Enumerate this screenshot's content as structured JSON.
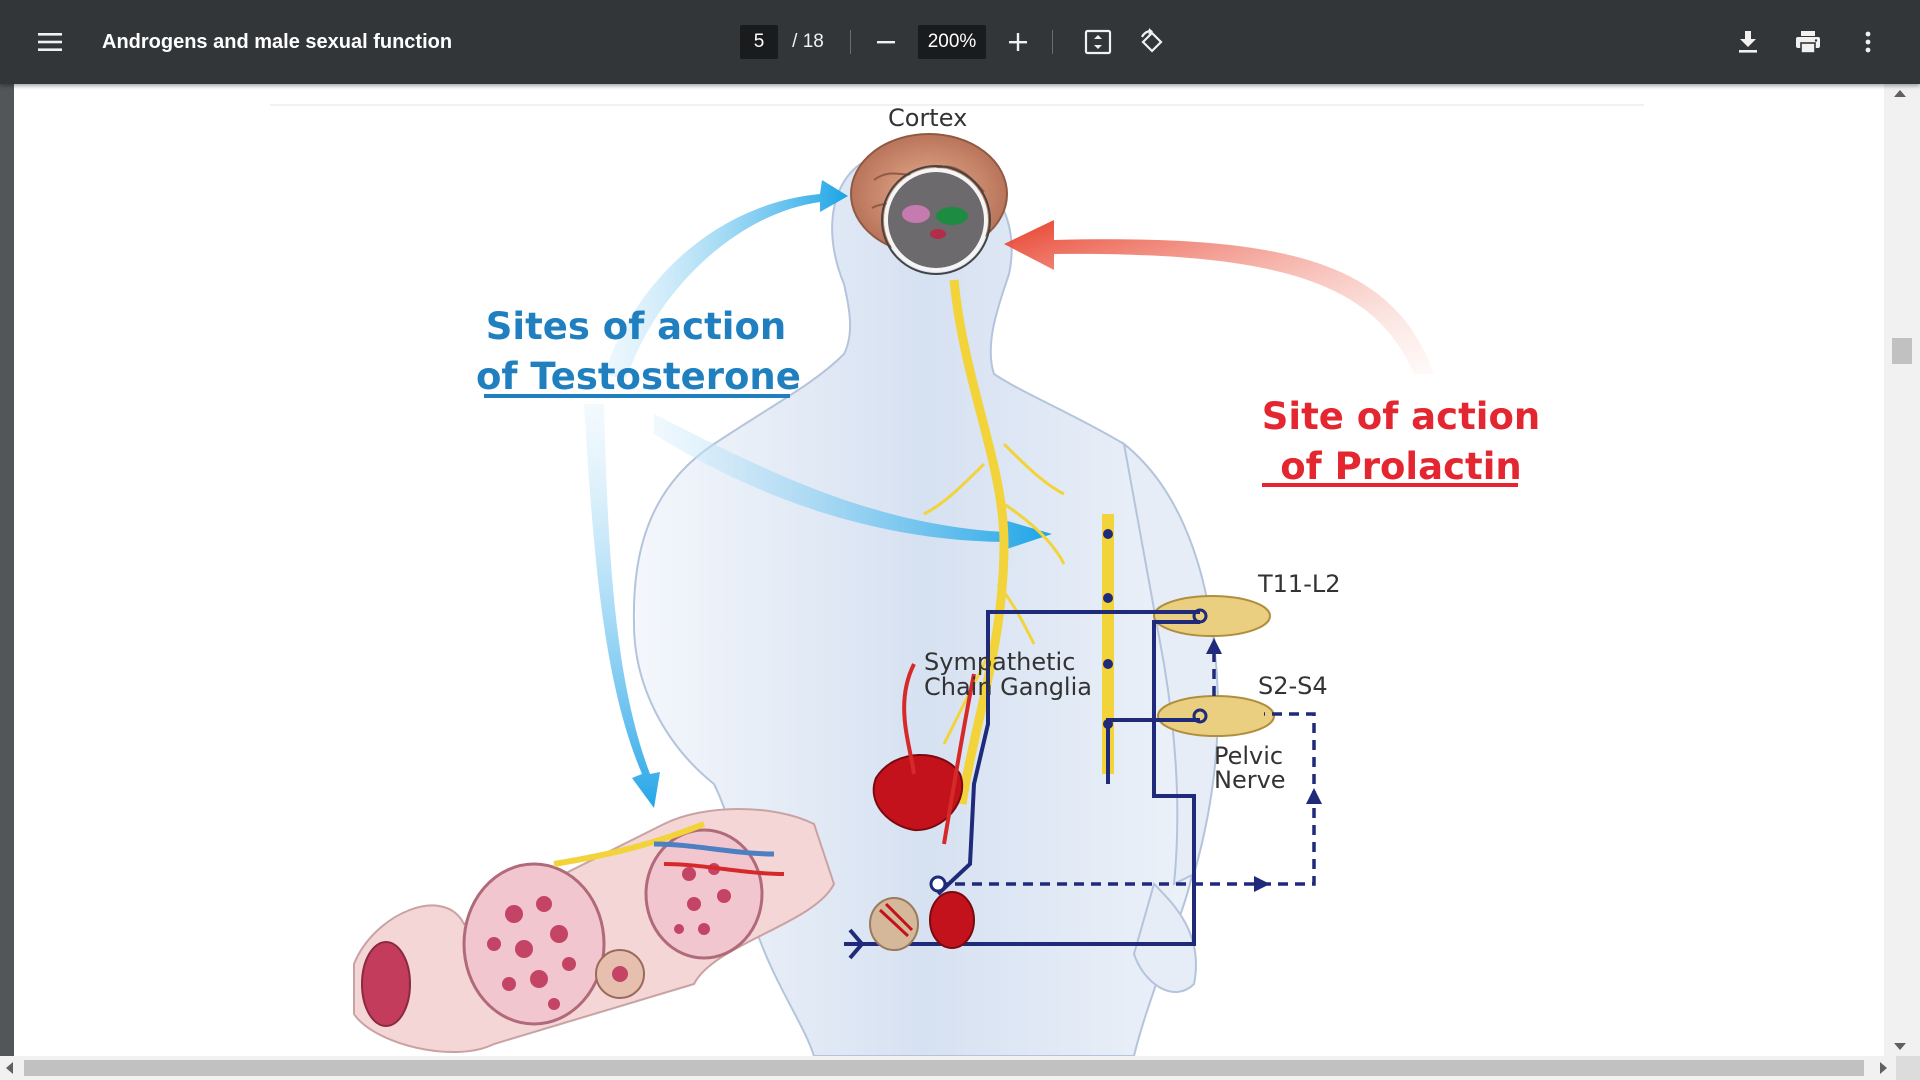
{
  "toolbar": {
    "title": "Androgens and male sexual function",
    "current_page": "5",
    "total_pages": "/ 18",
    "zoom": "200%",
    "icons": {
      "menu": "menu-icon",
      "zoom_out": "minus-icon",
      "zoom_in": "plus-icon",
      "fit": "fit-to-page-icon",
      "rotate": "rotate-icon",
      "download": "download-icon",
      "print": "print-icon",
      "more": "more-vert-icon"
    }
  },
  "figure": {
    "cortex": "Cortex",
    "testosterone_line1": "Sites of action",
    "testosterone_line2": "of Testosterone",
    "prolactin_line1": "Site of action",
    "prolactin_line2": "of Prolactin",
    "t11_l2": "T11-L2",
    "s2_s4": "S2-S4",
    "sympathetic_line1": "Sympathetic",
    "sympathetic_line2": "Chain Ganglia",
    "pelvic_line1": "Pelvic",
    "pelvic_line2": "Nerve",
    "colors": {
      "testosterone": "#1f7fbf",
      "prolactin": "#e3262f",
      "nerve": "#1f2a7a",
      "spinal": "#f2d33a",
      "body": "#dfe7f3"
    }
  }
}
